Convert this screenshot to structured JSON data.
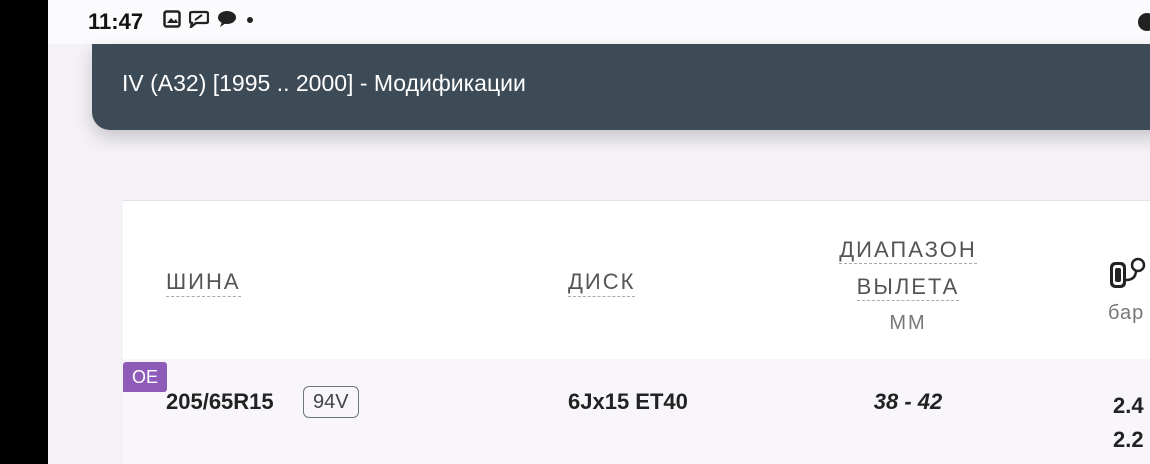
{
  "status_bar": {
    "time": "11:47",
    "icons": [
      "image-icon",
      "chat-icon",
      "message-bubble-icon",
      "dot-icon"
    ]
  },
  "header": {
    "title": "IV (A32) [1995 .. 2000] - Модификации"
  },
  "table": {
    "columns": {
      "tire": "ШИНА",
      "disk": "ДИСК",
      "range_line1": "ДИАПАЗОН",
      "range_line2": "ВЫЛЕТА",
      "range_unit": "ММ",
      "pressure_unit": "бар"
    },
    "rows": [
      {
        "badge": "OE",
        "tire_size": "205/65R15",
        "load_index": "94V",
        "disk": "6Jx15 ET40",
        "range": "38 - 42",
        "pressure_1": "2.4",
        "pressure_2": "2.2"
      }
    ]
  },
  "colors": {
    "header_bg": "#3d4b57",
    "badge_bg": "#8e5cb8"
  }
}
